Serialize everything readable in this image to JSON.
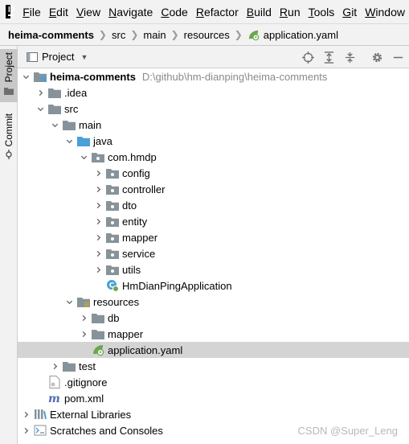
{
  "menubar": {
    "items": [
      {
        "mnemonic": "F",
        "rest": "ile"
      },
      {
        "mnemonic": "E",
        "rest": "dit"
      },
      {
        "mnemonic": "V",
        "rest": "iew"
      },
      {
        "mnemonic": "N",
        "rest": "avigate"
      },
      {
        "mnemonic": "C",
        "rest": "ode"
      },
      {
        "mnemonic": "R",
        "rest": "efactor"
      },
      {
        "mnemonic": "B",
        "rest": "uild"
      },
      {
        "mnemonic": "R",
        "rest": "un"
      },
      {
        "mnemonic": "T",
        "rest": "ools"
      },
      {
        "mnemonic": "G",
        "rest": "it"
      },
      {
        "mnemonic": "W",
        "rest": "indow"
      }
    ]
  },
  "breadcrumb": [
    "heima-comments",
    "src",
    "main",
    "resources",
    "application.yaml"
  ],
  "side": {
    "project_tab": "Project",
    "commit_tab": "Commit"
  },
  "panel": {
    "title": "Project"
  },
  "tree": [
    {
      "name": "heima-comments",
      "extra": "D:\\github\\hm-dianping\\heima-comments",
      "arrow": "down"
    },
    {
      "name": ".idea",
      "arrow": "right"
    },
    {
      "name": "src",
      "arrow": "down"
    },
    {
      "name": "main",
      "arrow": "down"
    },
    {
      "name": "java",
      "arrow": "down"
    },
    {
      "name": "com.hmdp",
      "arrow": "down"
    },
    {
      "name": "config",
      "arrow": "right"
    },
    {
      "name": "controller",
      "arrow": "right"
    },
    {
      "name": "dto",
      "arrow": "right"
    },
    {
      "name": "entity",
      "arrow": "right"
    },
    {
      "name": "mapper",
      "arrow": "right"
    },
    {
      "name": "service",
      "arrow": "right"
    },
    {
      "name": "utils",
      "arrow": "right"
    },
    {
      "name": "HmDianPingApplication",
      "arrow": "none"
    },
    {
      "name": "resources",
      "arrow": "down"
    },
    {
      "name": "db",
      "arrow": "right"
    },
    {
      "name": "mapper",
      "arrow": "right"
    },
    {
      "name": "application.yaml",
      "arrow": "none",
      "selected": true
    },
    {
      "name": "test",
      "arrow": "right"
    },
    {
      "name": ".gitignore",
      "arrow": "none"
    },
    {
      "name": "pom.xml",
      "arrow": "none"
    },
    {
      "name": "External Libraries",
      "arrow": "right"
    },
    {
      "name": "Scratches and Consoles",
      "arrow": "right"
    }
  ],
  "watermark": "CSDN @Super_Leng",
  "colors": {
    "folder": "#87939a",
    "source_folder": "#4aa0d8",
    "resources_folder": "#c9a53a",
    "selection": "#d4d4d4",
    "spring_green": "#6aa84f"
  }
}
